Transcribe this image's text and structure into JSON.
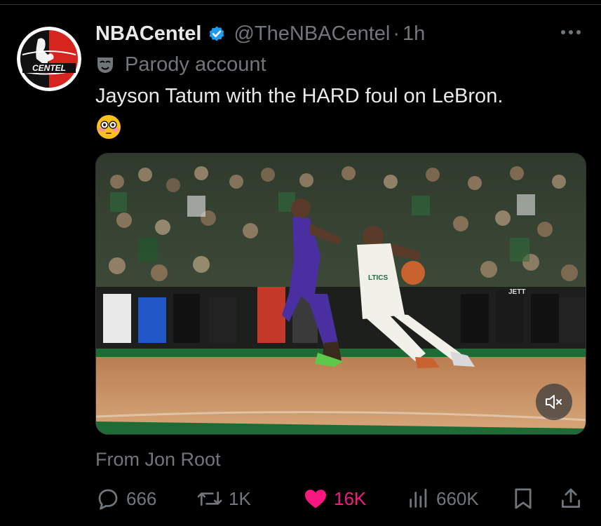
{
  "tweet": {
    "display_name": "NBACentel",
    "handle": "@TheNBACentel",
    "separator": "·",
    "time": "1h",
    "parody_label": "Parody account",
    "text": "Jayson Tatum with the HARD foul on LeBron.",
    "emoji": "flushed-face",
    "attribution": "From Jon Root",
    "avatar_text": "CENTEL",
    "media": {
      "type": "video",
      "jersey_text": "LTICS",
      "sign_text": "JETT"
    }
  },
  "actions": {
    "replies": "666",
    "reposts": "1K",
    "likes": "16K",
    "views": "660K"
  },
  "colors": {
    "background": "#000000",
    "text_primary": "#e7e9ea",
    "text_secondary": "#71767b",
    "verified_blue": "#1d9bf0",
    "like_pink": "#f91880",
    "avatar_red": "#d6241f"
  }
}
